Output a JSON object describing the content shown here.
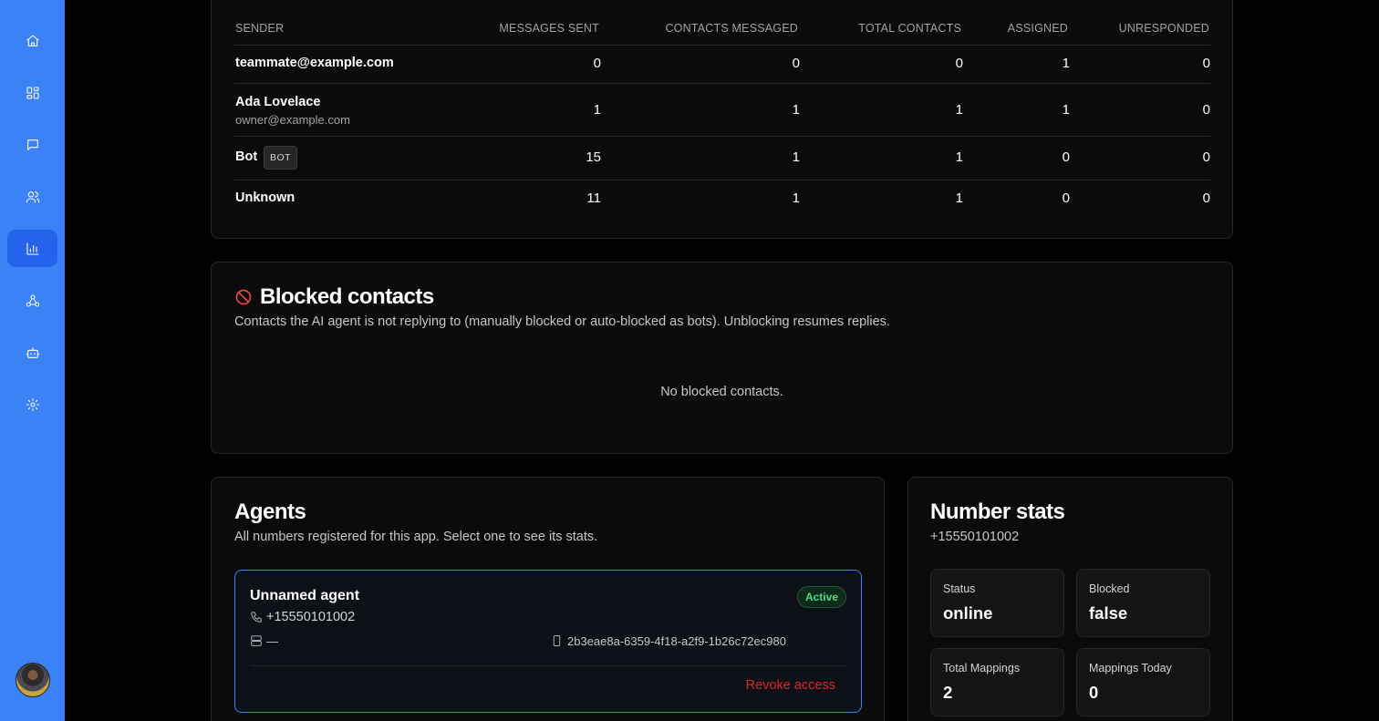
{
  "sidebar": {
    "items": [
      {
        "name": "home",
        "icon": "home-icon"
      },
      {
        "name": "dashboard",
        "icon": "grid-icon"
      },
      {
        "name": "messages",
        "icon": "chat-icon"
      },
      {
        "name": "contacts",
        "icon": "users-icon"
      },
      {
        "name": "analytics",
        "icon": "bar-chart-icon",
        "active": true
      },
      {
        "name": "integrations",
        "icon": "webhook-icon"
      },
      {
        "name": "bots",
        "icon": "bot-icon"
      },
      {
        "name": "settings",
        "icon": "gear-icon"
      }
    ],
    "accent": "#3b82f6"
  },
  "senders_table": {
    "headers": [
      "SENDER",
      "MESSAGES SENT",
      "CONTACTS MESSAGED",
      "TOTAL CONTACTS",
      "ASSIGNED",
      "UNRESPONDED"
    ],
    "rows": [
      {
        "name": "teammate@example.com",
        "email": "",
        "badge": "",
        "messages_sent": "0",
        "contacts_messaged": "0",
        "total_contacts": "0",
        "assigned": "1",
        "unresponded": "0"
      },
      {
        "name": "Ada Lovelace",
        "email": "owner@example.com",
        "badge": "",
        "messages_sent": "1",
        "contacts_messaged": "1",
        "total_contacts": "1",
        "assigned": "1",
        "unresponded": "0"
      },
      {
        "name": "Bot",
        "email": "",
        "badge": "BOT",
        "messages_sent": "15",
        "contacts_messaged": "1",
        "total_contacts": "1",
        "assigned": "0",
        "unresponded": "0"
      },
      {
        "name": "Unknown",
        "email": "",
        "badge": "",
        "messages_sent": "11",
        "contacts_messaged": "1",
        "total_contacts": "1",
        "assigned": "0",
        "unresponded": "0"
      }
    ]
  },
  "blocked": {
    "icon": "ban-icon",
    "title": "Blocked contacts",
    "description": "Contacts the AI agent is not replying to (manually blocked or auto-blocked as bots). Unblocking resumes replies.",
    "empty_text": "No blocked contacts."
  },
  "agents": {
    "title": "Agents",
    "description": "All numbers registered for this app. Select one to see its stats.",
    "items": [
      {
        "name": "Unnamed agent",
        "phone": "+15550101002",
        "server": "—",
        "device_id": "2b3eae8a-6359-4f18-a2f9-1b26c72ec980",
        "status_badge": "Active",
        "revoke_label": "Revoke access"
      }
    ]
  },
  "number_stats": {
    "title": "Number stats",
    "phone": "+15550101002",
    "stats": [
      {
        "label": "Status",
        "value": "online"
      },
      {
        "label": "Blocked",
        "value": "false"
      },
      {
        "label": "Total Mappings",
        "value": "2"
      },
      {
        "label": "Mappings Today",
        "value": "0"
      }
    ]
  }
}
